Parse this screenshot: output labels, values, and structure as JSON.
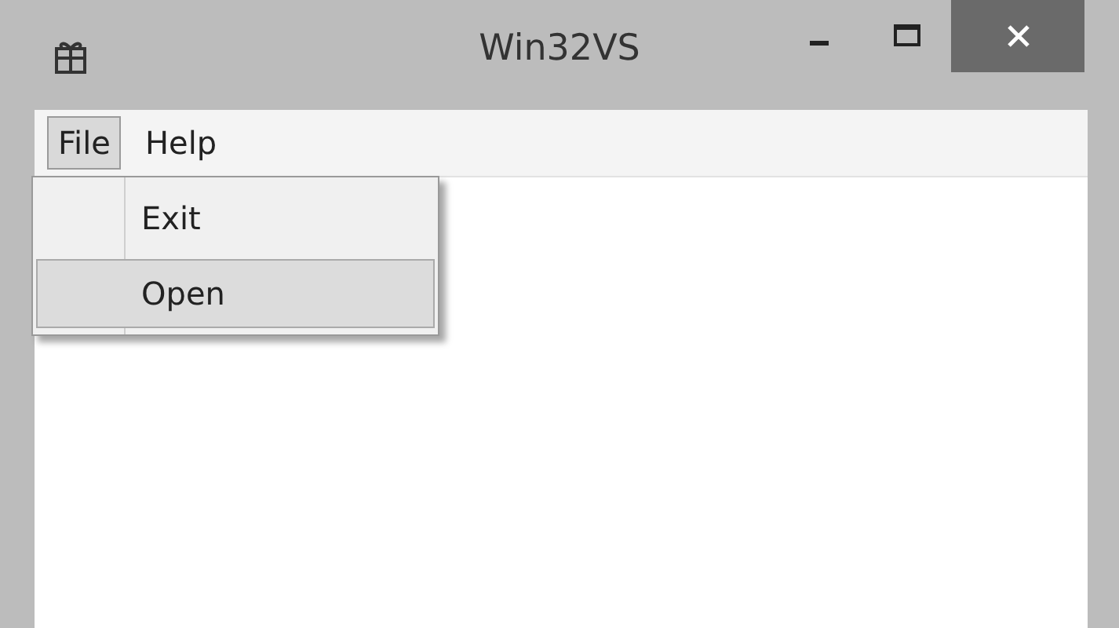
{
  "window": {
    "title": "Win32VS"
  },
  "menu": [
    {
      "label": "File",
      "selected": true
    },
    {
      "label": "Help",
      "selected": false
    }
  ],
  "dropdown": [
    {
      "label": "Exit",
      "selected": false
    },
    {
      "label": "Open",
      "selected": true
    }
  ]
}
